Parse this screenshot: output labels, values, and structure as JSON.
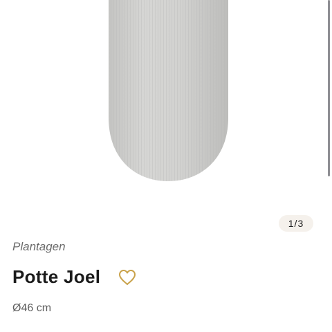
{
  "gallery": {
    "image_alt": "",
    "current_page": 1,
    "total_pages": 3,
    "page_indicator_text": "1/3"
  },
  "product": {
    "brand": "Plantagen",
    "name": "Potte Joel",
    "size": "Ø46 cm",
    "favorite_icon": "heart-outline-icon"
  },
  "colors": {
    "heart": "#c9a24a",
    "pot": "#d3d3d1",
    "indicator_bg": "#f5f1ec"
  }
}
